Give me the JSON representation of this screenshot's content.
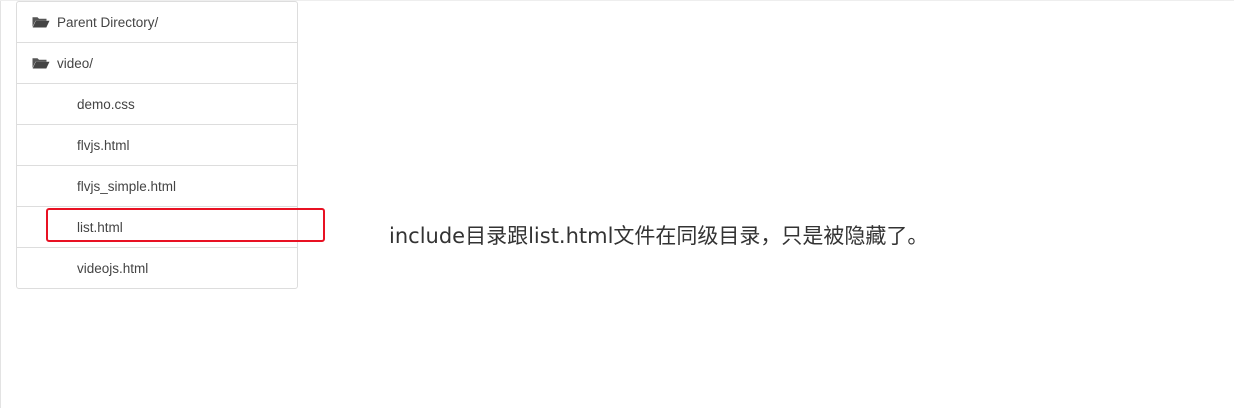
{
  "file_list": {
    "items": [
      {
        "type": "dir",
        "label": "Parent Directory/",
        "icon": "folder-open-icon"
      },
      {
        "type": "dir",
        "label": "video/",
        "icon": "folder-open-icon"
      },
      {
        "type": "file",
        "label": "demo.css"
      },
      {
        "type": "file",
        "label": "flvjs.html"
      },
      {
        "type": "file",
        "label": "flvjs_simple.html"
      },
      {
        "type": "file",
        "label": "list.html"
      },
      {
        "type": "file",
        "label": "videojs.html"
      }
    ]
  },
  "annotation": {
    "highlight_color": "#e81123",
    "note": "include目录跟list.html文件在同级目录，只是被隐藏了。"
  }
}
